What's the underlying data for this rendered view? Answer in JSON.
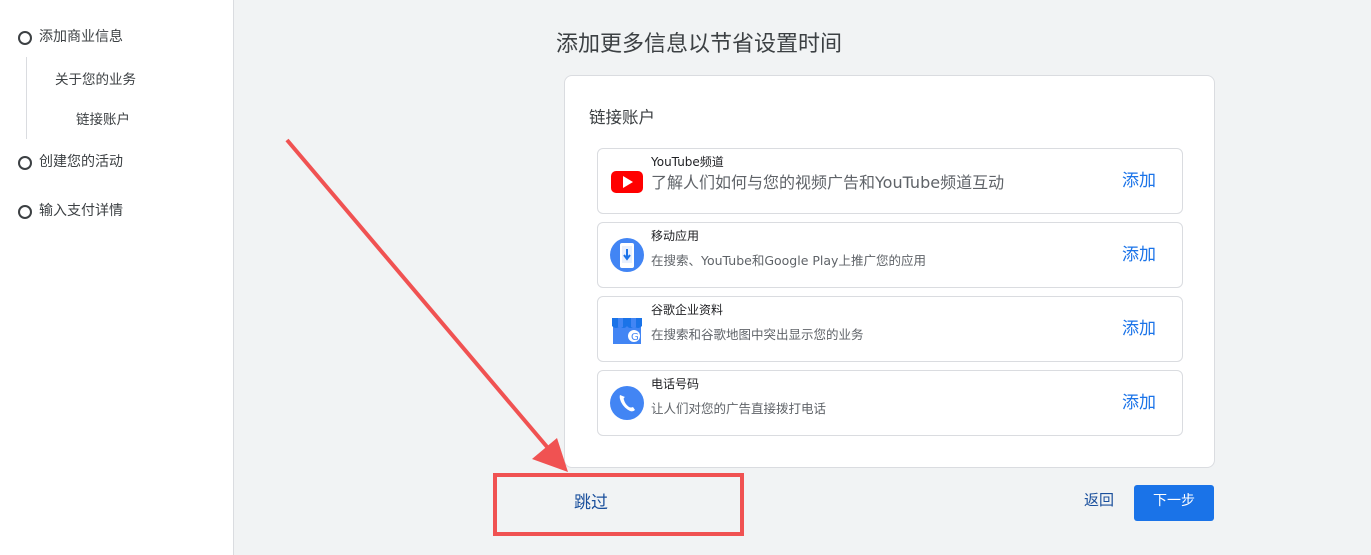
{
  "sidebar": {
    "steps": [
      {
        "label": "添加商业信息"
      },
      {
        "label": "创建您的活动"
      },
      {
        "label": "输入支付详情"
      }
    ],
    "substeps": [
      {
        "label": "关于您的业务"
      },
      {
        "label": "链接账户"
      }
    ]
  },
  "main": {
    "title": "添加更多信息以节省设置时间",
    "card_title": "链接账户",
    "rows": [
      {
        "title": "YouTube频道",
        "desc": "了解人们如何与您的视频广告和YouTube频道互动",
        "action": "添加",
        "icon": "youtube-icon"
      },
      {
        "title": "移动应用",
        "desc": "在搜索、YouTube和Google Play上推广您的应用",
        "action": "添加",
        "icon": "mobile-app-icon"
      },
      {
        "title": "谷歌企业资料",
        "desc": "在搜索和谷歌地图中突出显示您的业务",
        "action": "添加",
        "icon": "business-profile-icon"
      },
      {
        "title": "电话号码",
        "desc": "让人们对您的广告直接拨打电话",
        "action": "添加",
        "icon": "phone-icon"
      }
    ]
  },
  "footer": {
    "skip": "跳过",
    "back": "返回",
    "next": "下一步"
  },
  "colors": {
    "accent": "#1a73e8",
    "annotation": "#f05252",
    "youtube_red": "#ff0000"
  }
}
